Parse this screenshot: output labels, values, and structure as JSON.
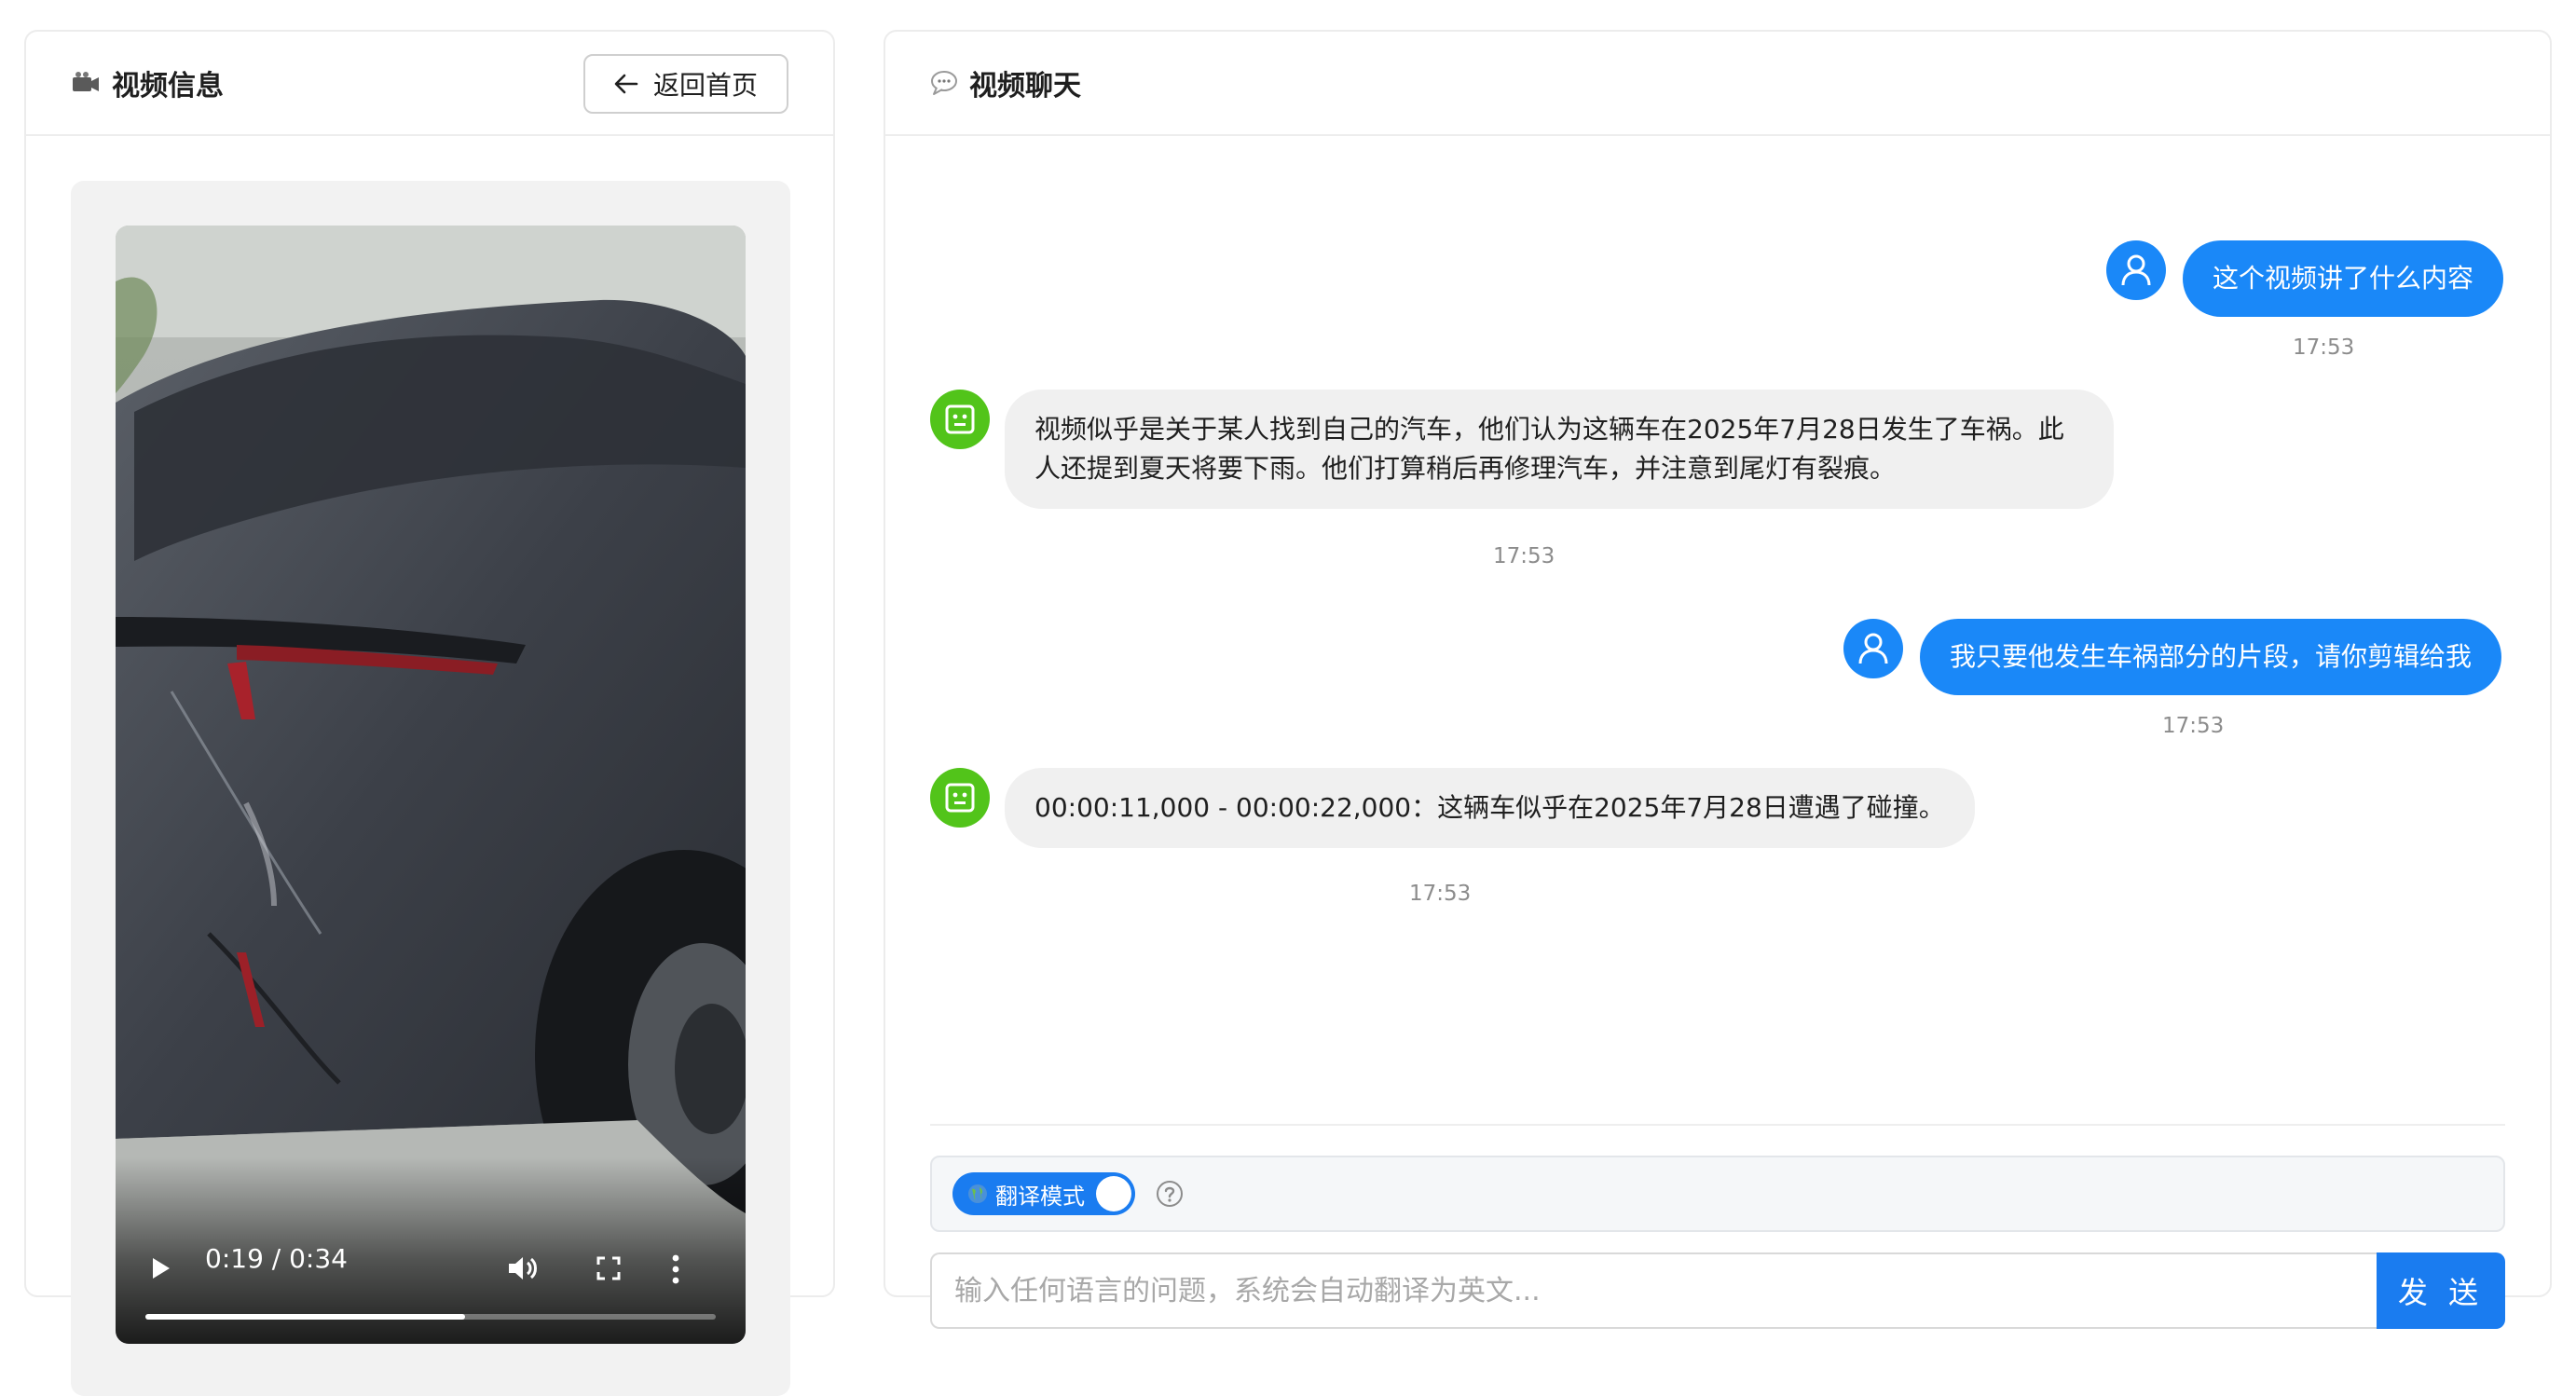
{
  "left_panel": {
    "title": "视频信息",
    "title_icon": "video-camera-icon",
    "back_button": {
      "label": "返回首页",
      "icon": "arrow-left-icon"
    }
  },
  "video": {
    "time": "0:19 / 0:34",
    "progress": 0.56,
    "controls": [
      "play-icon",
      "volume-icon",
      "fullscreen-icon",
      "more-icon"
    ]
  },
  "right_panel": {
    "title": "视频聊天",
    "title_icon": "speech-bubble-icon"
  },
  "messages": [
    {
      "role": "user",
      "text": "这个视频讲了什么内容",
      "time": "17:53"
    },
    {
      "role": "bot",
      "text": "视频似乎是关于某人找到自己的汽车，他们认为这辆车在2025年7月28日发生了车祸。此人还提到夏天将要下雨。他们打算稍后再修理汽车，并注意到尾灯有裂痕。",
      "time": "17:53"
    },
    {
      "role": "user",
      "text": "我只要他发生车祸部分的片段，请你剪辑给我",
      "time": "17:53"
    },
    {
      "role": "bot",
      "text": "00:00:11,000 - 00:00:22,000：这辆车似乎在2025年7月28日遭遇了碰撞。",
      "time": "17:53"
    }
  ],
  "translate": {
    "label": "翻译模式",
    "icon": "globe-icon",
    "enabled": true
  },
  "input": {
    "placeholder": "输入任何语言的问题，系统会自动翻译为英文...",
    "value": "",
    "send_label": "发 送"
  },
  "colors": {
    "primary": "#1a88f8",
    "bot_avatar": "#52c41a",
    "bubble_bot": "#f0f0f0"
  }
}
